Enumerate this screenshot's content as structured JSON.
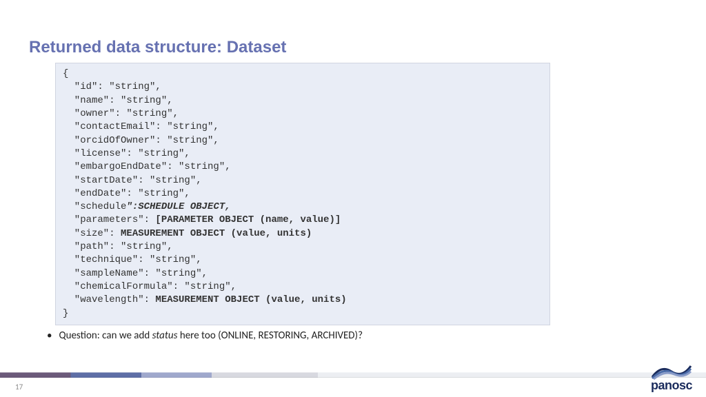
{
  "title": "Returned data structure: Dataset",
  "code": {
    "open": "{",
    "lines": [
      "  \"id\": \"string\",",
      "  \"name\": \"string\",",
      "  \"owner\": \"string\",",
      "  \"contactEmail\": \"string\",",
      "  \"orcidOfOwner\": \"string\",",
      "  \"license\": \"string\",",
      "  \"embargoEndDate\": \"string\",",
      "  \"startDate\": \"string\",",
      "  \"endDate\": \"string\","
    ],
    "schedule_prefix": "  \"schedule",
    "schedule_suffix": "\":SCHEDULE OBJECT,",
    "params_prefix": "  \"parameters\": ",
    "params_bold": "[PARAMETER OBJECT (name, value)]",
    "size_prefix": "  \"size\": ",
    "size_bold": "MEASUREMENT OBJECT (value, units)",
    "lines2": [
      "  \"path\": \"string\",",
      "  \"technique\": \"string\",",
      "  \"sampleName\": \"string\",",
      "  \"chemicalFormula\": \"string\","
    ],
    "wave_prefix": "  \"wavelength\": ",
    "wave_bold": "MEASUREMENT OBJECT (value, units)",
    "close": "}"
  },
  "bullet": {
    "prefix": "Question: can we add ",
    "italic": "status",
    "suffix": " here too (ONLINE, RESTORING, ARCHIVED)?"
  },
  "page_number": "17",
  "logo": {
    "text_dark": "panosc"
  }
}
